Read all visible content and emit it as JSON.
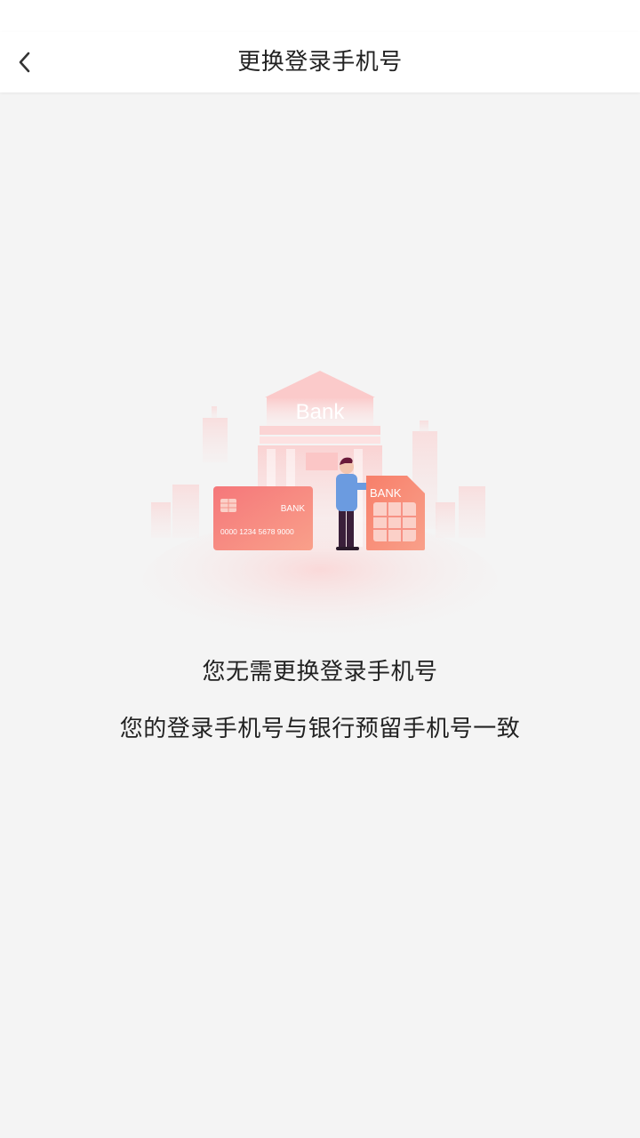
{
  "nav": {
    "title": "更换登录手机号",
    "back_icon": "chevron-left-icon"
  },
  "illustration": {
    "bank_sign": "Bank",
    "card_label": "BANK",
    "card_number": "0000  1234  5678  9000",
    "sim_label": "BANK",
    "accent_color": "#f36b6b"
  },
  "message": {
    "title": "您无需更换登录手机号",
    "detail": "您的登录手机号与银行预留手机号一致"
  }
}
